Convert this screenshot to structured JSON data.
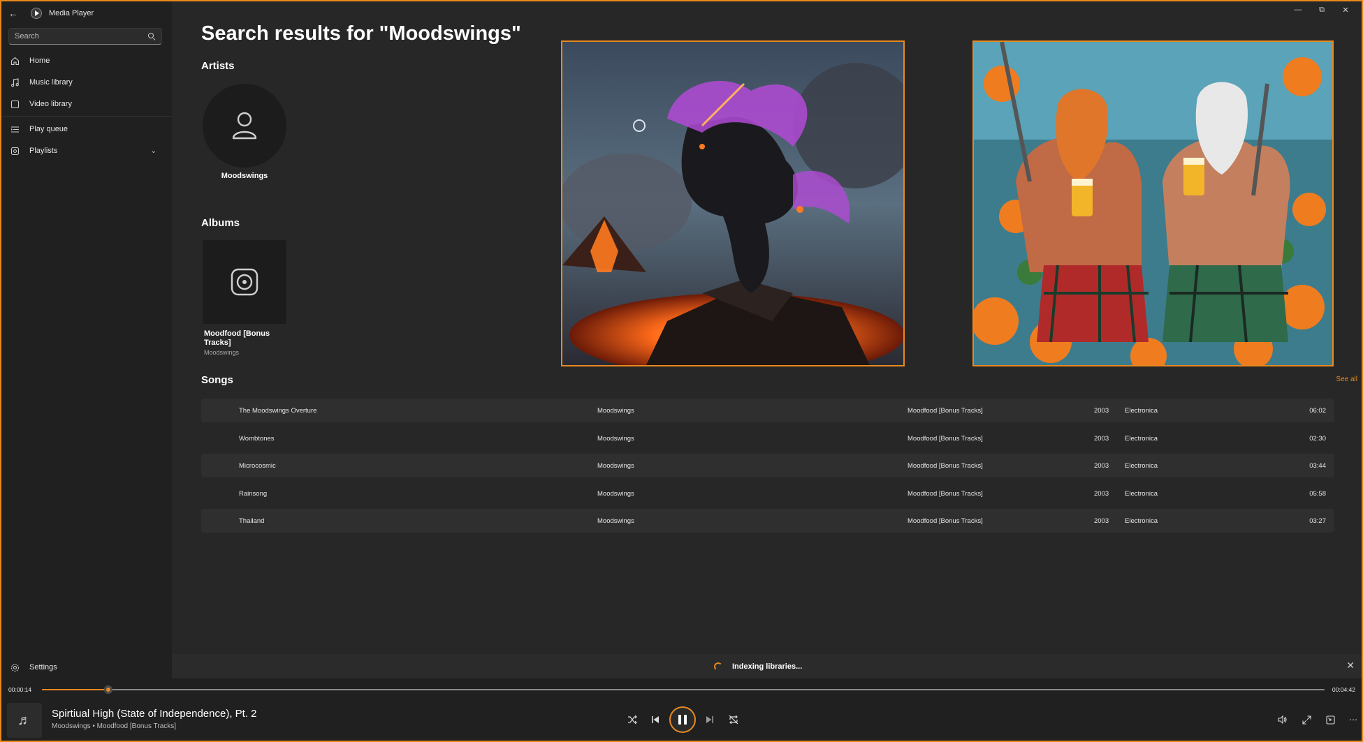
{
  "app": {
    "title": "Media Player"
  },
  "search": {
    "placeholder": "Search"
  },
  "sidebar": {
    "items": [
      {
        "label": "Home",
        "icon": "home-icon"
      },
      {
        "label": "Music library",
        "icon": "music-note-icon"
      },
      {
        "label": "Video library",
        "icon": "video-icon"
      },
      {
        "label": "Play queue",
        "icon": "queue-icon"
      },
      {
        "label": "Playlists",
        "icon": "playlist-icon"
      }
    ],
    "settings_label": "Settings"
  },
  "main": {
    "title": "Search results for \"Moodswings\"",
    "artists_heading": "Artists",
    "artist": {
      "name": "Moodswings"
    },
    "albums_heading": "Albums",
    "album": {
      "title": "Moodfood [Bonus Tracks]",
      "artist": "Moodswings"
    },
    "songs_heading": "Songs",
    "see_all_label": "See all",
    "songs": [
      {
        "title": "The Moodswings Overture",
        "artist": "Moodswings",
        "album": "Moodfood [Bonus Tracks]",
        "year": "2003",
        "genre": "Electronica",
        "duration": "06:02"
      },
      {
        "title": "Wombtones",
        "artist": "Moodswings",
        "album": "Moodfood [Bonus Tracks]",
        "year": "2003",
        "genre": "Electronica",
        "duration": "02:30"
      },
      {
        "title": "Microcosmic",
        "artist": "Moodswings",
        "album": "Moodfood [Bonus Tracks]",
        "year": "2003",
        "genre": "Electronica",
        "duration": "03:44"
      },
      {
        "title": "Rainsong",
        "artist": "Moodswings",
        "album": "Moodfood [Bonus Tracks]",
        "year": "2003",
        "genre": "Electronica",
        "duration": "05:58"
      },
      {
        "title": "Thailand",
        "artist": "Moodswings",
        "album": "Moodfood [Bonus Tracks]",
        "year": "2003",
        "genre": "Electronica",
        "duration": "03:27"
      }
    ]
  },
  "indexing": {
    "text": "Indexing libraries..."
  },
  "player": {
    "current_time": "00:00:14",
    "total_time": "00:04:42",
    "progress_fraction": 0.052,
    "track_title": "Spirtiual High (State of Independence), Pt. 2",
    "track_subtitle": "Moodswings • Moodfood [Bonus Tracks]"
  },
  "colors": {
    "accent": "#e8891e",
    "background": "#202020",
    "content": "#272727"
  }
}
